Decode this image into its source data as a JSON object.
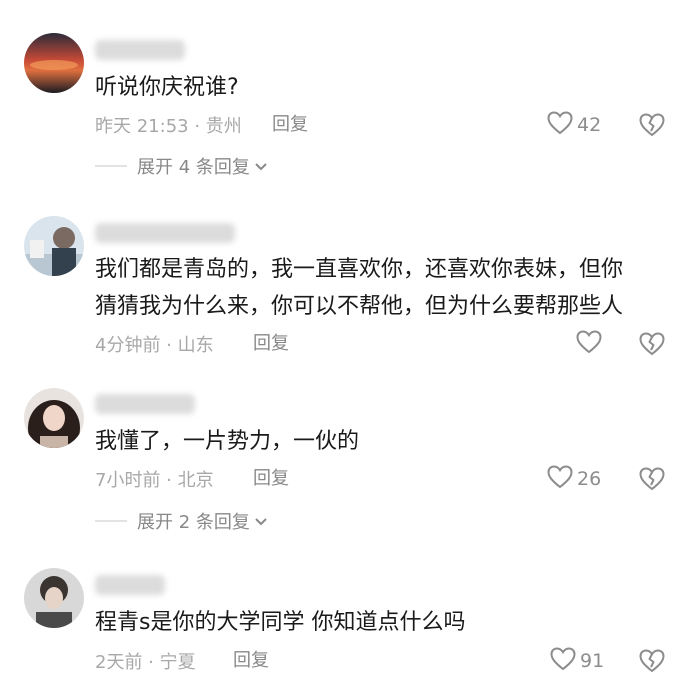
{
  "comments": [
    {
      "text": "听说你庆祝谁?",
      "meta": "昨天 21:53 · 贵州",
      "reply_label": "回复",
      "likes": "42",
      "expand_label": "展开 4 条回复"
    },
    {
      "text": "我们都是青岛的，我一直喜欢你，还喜欢你表妹，但你\n猜猜我为什么来，你可以不帮他，但为什么要帮那些人",
      "meta": "4分钟前 · 山东",
      "reply_label": "回复",
      "likes": ""
    },
    {
      "text": "我懂了，一片势力，一伙的",
      "meta": "7小时前 · 北京",
      "reply_label": "回复",
      "likes": "26",
      "expand_label": "展开 2 条回复"
    },
    {
      "text": "程青s是你的大学同学 你知道点什么吗",
      "meta": "2天前 · 宁夏",
      "reply_label": "回复",
      "likes": "91"
    }
  ],
  "icons": {
    "like": "heart-outline-icon",
    "dislike": "broken-heart-icon",
    "expand": "chevron-down-icon"
  },
  "colors": {
    "text": "#1a1a1a",
    "meta": "#a8a8a8",
    "icon": "#8c8c8c"
  }
}
